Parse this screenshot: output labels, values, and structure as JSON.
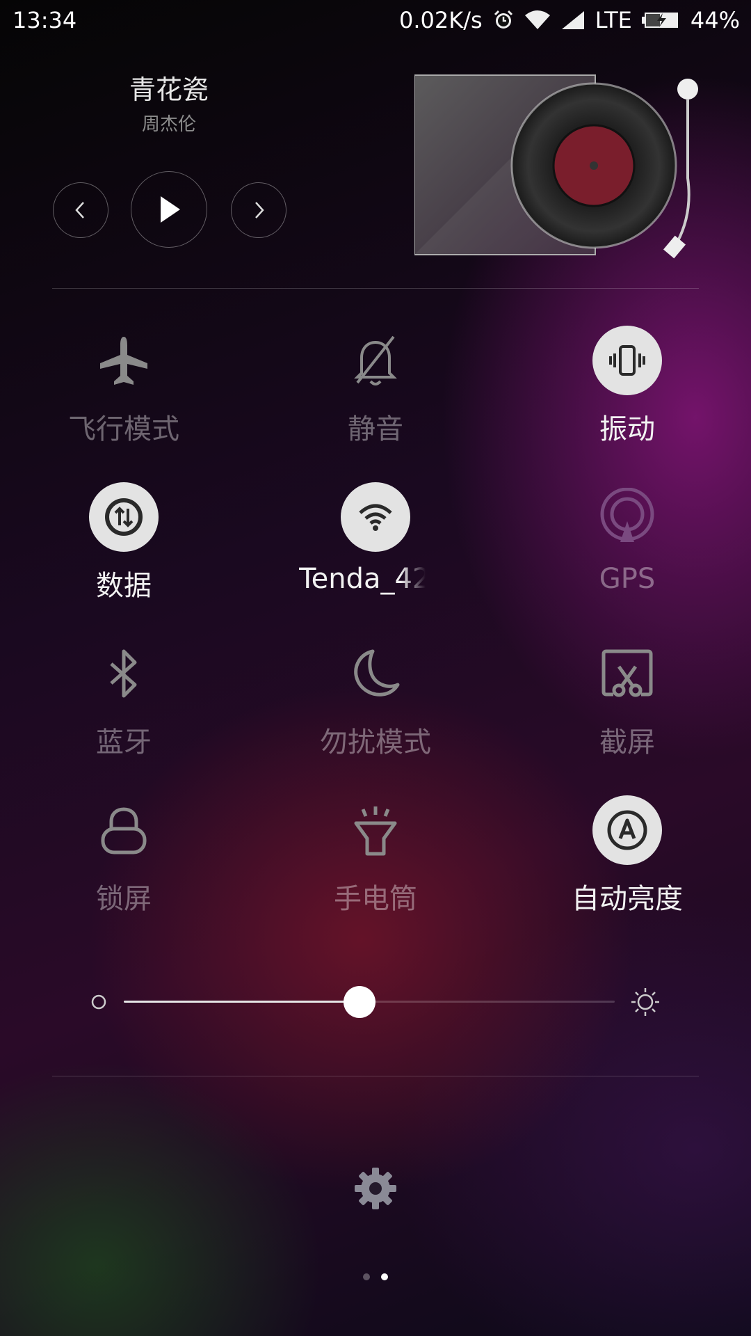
{
  "status_bar": {
    "time": "13:34",
    "net_speed": "0.02K/s",
    "network": "LTE",
    "battery": "44%",
    "icons": [
      "alarm-icon",
      "wifi-icon",
      "signal-icon",
      "battery-charging-icon"
    ]
  },
  "music": {
    "title": "青花瓷",
    "artist": "周杰伦",
    "controls": [
      "previous-icon",
      "play-icon",
      "next-icon"
    ],
    "disc_color": "#7a1e2c"
  },
  "toggles": [
    {
      "label": "飞行模式",
      "icon": "airplane-icon",
      "active": false
    },
    {
      "label": "静音",
      "icon": "bell-off-icon",
      "active": false
    },
    {
      "label": "振动",
      "icon": "vibrate-icon",
      "active": true
    },
    {
      "label": "数据",
      "icon": "mobile-data-icon",
      "active": true
    },
    {
      "label": "Tenda_42",
      "icon": "wifi-icon",
      "active": true
    },
    {
      "label": "GPS",
      "icon": "gps-icon",
      "active": false
    },
    {
      "label": "蓝牙",
      "icon": "bluetooth-icon",
      "active": false
    },
    {
      "label": "勿扰模式",
      "icon": "moon-icon",
      "active": false
    },
    {
      "label": "截屏",
      "icon": "screenshot-icon",
      "active": false
    },
    {
      "label": "锁屏",
      "icon": "lock-icon",
      "active": false
    },
    {
      "label": "手电筒",
      "icon": "flashlight-icon",
      "active": false
    },
    {
      "label": "自动亮度",
      "icon": "auto-brightness-icon",
      "active": true
    }
  ],
  "brightness": {
    "level_percent": 48
  },
  "pager": {
    "pages": 2,
    "current": 2
  },
  "colors": {
    "active_circle": "#e3e3e3",
    "icon_dark": "#2a2a2a"
  }
}
